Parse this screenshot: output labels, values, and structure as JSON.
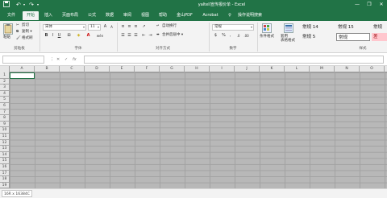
{
  "window": {
    "title": "yaltell宣传报价单 - Excel",
    "minimize_icon": "minimize-icon",
    "restore_icon": "restore-icon",
    "close_icon": "close-icon"
  },
  "quick_access": {
    "save_icon": "save-icon",
    "undo_icon": "undo-icon",
    "redo_icon": "redo-icon",
    "customize_icon": "chevron-down-icon"
  },
  "tabs": [
    {
      "label": "文件"
    },
    {
      "label": "开始"
    },
    {
      "label": "插入"
    },
    {
      "label": "页面布局"
    },
    {
      "label": "公式"
    },
    {
      "label": "数据"
    },
    {
      "label": "审阅"
    },
    {
      "label": "视图"
    },
    {
      "label": "帮助"
    },
    {
      "label": "金山PDF"
    },
    {
      "label": "Acrobat"
    },
    {
      "label": "操作说明搜索"
    }
  ],
  "ribbon": {
    "clipboard": {
      "paste": "粘贴",
      "cut": "剪切",
      "copy": "复制 ▾",
      "format_painter": "格式刷",
      "group_label": "剪贴板"
    },
    "font": {
      "font_name": "宋体",
      "font_size": "11",
      "grow": "A",
      "shrink": "A",
      "bold": "B",
      "italic": "I",
      "underline": "U",
      "phonetic": "wén",
      "group_label": "字体"
    },
    "alignment": {
      "wrap_text": "自动换行",
      "merge_center": "合并后居中 ▾",
      "group_label": "对齐方式"
    },
    "number": {
      "format": "常规",
      "currency": "$",
      "percent": "%",
      "comma": ",",
      "group_label": "数字"
    },
    "styles": {
      "conditional": "条件格式",
      "table_format": "套用\n表格格式",
      "cell_styles": [
        {
          "label": "常规 14"
        },
        {
          "label": "常规 15"
        },
        {
          "label": "常规 5"
        },
        {
          "label": "常规"
        },
        {
          "label": "差"
        }
      ],
      "group_label": "样式"
    }
  },
  "formula_bar": {
    "name_box": "",
    "cancel": "✕",
    "enter": "✓",
    "fx": "fx",
    "value": ""
  },
  "grid": {
    "columns": [
      "A",
      "B",
      "C",
      "D",
      "E",
      "F",
      "G",
      "H",
      "I",
      "J",
      "K",
      "L",
      "M",
      "N",
      "O"
    ],
    "rows": [
      "1",
      "2",
      "3",
      "4",
      "5",
      "6",
      "7",
      "8",
      "9",
      "10",
      "11",
      "12",
      "13",
      "14",
      "15",
      "16",
      "17",
      "18",
      "19"
    ]
  },
  "status": {
    "selection": "16R x 16384C"
  },
  "colors": {
    "accent": "#217346",
    "sheet_gray": "#b8b8b8"
  }
}
